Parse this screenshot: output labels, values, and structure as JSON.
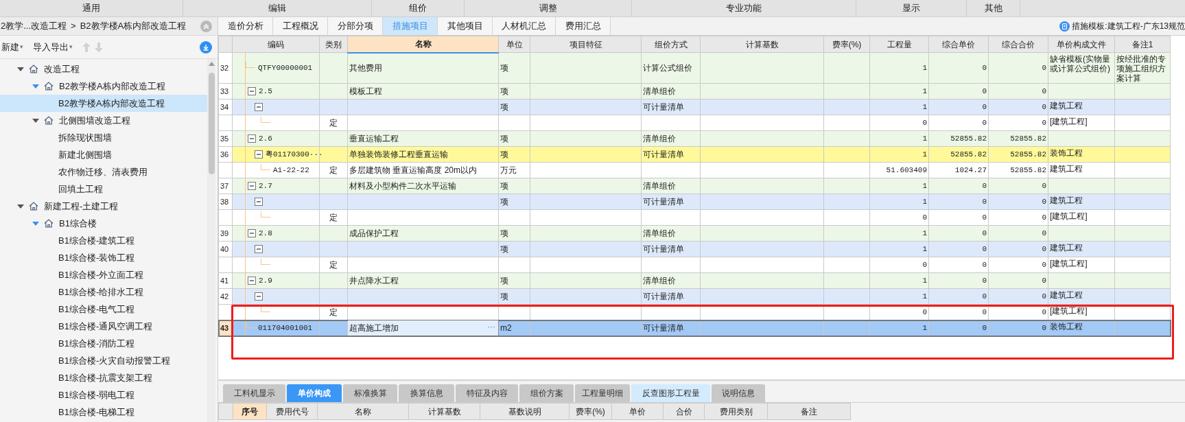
{
  "menu": [
    {
      "label": "通用"
    },
    {
      "label": "编辑"
    },
    {
      "label": "组价"
    },
    {
      "label": "调整"
    },
    {
      "label": "专业功能"
    },
    {
      "label": "显示"
    },
    {
      "label": "其他"
    }
  ],
  "breadcrumb": [
    "2教学...改造工程",
    ">",
    "B2教学楼A栋内部改造工程"
  ],
  "toolbar": [
    {
      "label": "新建",
      "caret": "▾"
    },
    {
      "label": "导入导出",
      "caret": "▾"
    }
  ],
  "tree": [
    {
      "label": "改造工程",
      "expanded": true,
      "selected": false,
      "children": [
        {
          "label": "B2教学楼A栋内部改造工程",
          "expanded": true,
          "selected": false,
          "children": [
            {
              "label": "B2教学楼A栋内部改造工程",
              "selected": true
            }
          ]
        },
        {
          "label": "北侧围墙改造工程",
          "expanded": true,
          "selected": false,
          "children": [
            {
              "label": "拆除现状围墙",
              "selected": false
            },
            {
              "label": "新建北侧围墙",
              "selected": false
            },
            {
              "label": "农作物迁移、清表费用",
              "selected": false
            },
            {
              "label": "回填土工程",
              "selected": false
            }
          ]
        }
      ]
    },
    {
      "label": "新建工程-土建工程",
      "expanded": true,
      "selected": false,
      "children": [
        {
          "label": "B1综合楼",
          "expanded": true,
          "selected": false,
          "children": [
            {
              "label": "B1综合楼-建筑工程",
              "selected": false
            },
            {
              "label": "B1综合楼-装饰工程",
              "selected": false
            },
            {
              "label": "B1综合楼-外立面工程",
              "selected": false
            },
            {
              "label": "B1综合楼-给排水工程",
              "selected": false
            },
            {
              "label": "B1综合楼-电气工程",
              "selected": false
            },
            {
              "label": "B1综合楼-通风空调工程",
              "selected": false
            },
            {
              "label": "B1综合楼-消防工程",
              "selected": false
            },
            {
              "label": "B1综合楼-火灾自动报警工程",
              "selected": false
            },
            {
              "label": "B1综合楼-抗震支架工程",
              "selected": false
            },
            {
              "label": "B1综合楼-弱电工程",
              "selected": false
            },
            {
              "label": "B1综合楼-电梯工程",
              "selected": false
            }
          ]
        }
      ]
    }
  ],
  "tabs": [
    {
      "label": "造价分析",
      "selected": false
    },
    {
      "label": "工程概况",
      "selected": false
    },
    {
      "label": "分部分项",
      "selected": false
    },
    {
      "label": "措施项目",
      "selected": true
    },
    {
      "label": "其他项目",
      "selected": false
    },
    {
      "label": "人材机汇总",
      "selected": false
    },
    {
      "label": "费用汇总",
      "selected": false
    }
  ],
  "template_label": "措施模板:建筑工程-广东13规范",
  "table": {
    "columns": [
      {
        "label": "编码",
        "selected": false
      },
      {
        "label": "类别",
        "selected": false
      },
      {
        "label": "名称",
        "selected": true
      },
      {
        "label": "单位",
        "selected": false
      },
      {
        "label": "项目特征",
        "selected": false
      },
      {
        "label": "组价方式",
        "selected": false
      },
      {
        "label": "计算基数",
        "selected": false
      },
      {
        "label": "费率(%)",
        "selected": false
      },
      {
        "label": "工程量",
        "selected": false
      },
      {
        "label": "综合单价",
        "selected": false
      },
      {
        "label": "综合合价",
        "selected": false
      },
      {
        "label": "单价构成文件",
        "selected": false
      },
      {
        "label": "备注1",
        "selected": false
      }
    ],
    "rows": [
      {
        "number": "32",
        "kind": "measure",
        "selected": false,
        "highlighted": false,
        "code": "QTFY00000001",
        "name": "其他费用",
        "unit": "项",
        "method": "计算公式组价",
        "quantity": "1",
        "unit_price": "0",
        "total_price": "0",
        "price_file": "缺省模板(实物量或计算公式组价)",
        "note1": "按经批准的专项施工组织方案计算"
      },
      {
        "number": "33",
        "kind": "measure",
        "selected": false,
        "highlighted": false,
        "expanded": true,
        "code": "2.5",
        "name": "模板工程",
        "unit": "项",
        "method": "清单组价",
        "quantity": "1",
        "unit_price": "0",
        "total_price": "0",
        "children": [
          {
            "number": "34",
            "kind": "list",
            "selected": false,
            "highlighted": false,
            "expanded": true,
            "unit": "项",
            "method": "可计量清单",
            "quantity": "1",
            "unit_price": "0",
            "total_price": "0",
            "price_file": "建筑工程",
            "children": [
              {
                "kind": "quota",
                "selected": false,
                "highlighted": false,
                "type": "定",
                "quantity": "0",
                "unit_price": "0",
                "total_price": "0",
                "price_file": "[建筑工程]"
              }
            ]
          }
        ]
      },
      {
        "number": "35",
        "kind": "measure",
        "selected": false,
        "highlighted": false,
        "expanded": true,
        "code": "2.6",
        "name": "垂直运输工程",
        "unit": "项",
        "method": "清单组价",
        "quantity": "1",
        "unit_price": "52855.82",
        "total_price": "52855.82",
        "children": [
          {
            "number": "36",
            "kind": "list",
            "selected": false,
            "highlighted": true,
            "expanded": true,
            "code": "粤01170300···",
            "name": "单独装饰装修工程垂直运输",
            "unit": "项",
            "method": "可计量清单",
            "quantity": "1",
            "unit_price": "52855.82",
            "total_price": "52855.82",
            "price_file": "装饰工程",
            "children": [
              {
                "kind": "quota",
                "selected": false,
                "highlighted": false,
                "code": "A1-22-22",
                "type": "定",
                "name": "多层建筑物 垂直运输高度 20m以内",
                "unit": "万元",
                "quantity": "51.603409",
                "unit_price": "1024.27",
                "total_price": "52855.82",
                "price_file": "建筑工程"
              }
            ]
          }
        ]
      },
      {
        "number": "37",
        "kind": "measure",
        "selected": false,
        "highlighted": false,
        "expanded": true,
        "code": "2.7",
        "name": "材料及小型构件二次水平运输",
        "unit": "项",
        "method": "清单组价",
        "quantity": "1",
        "unit_price": "0",
        "total_price": "0",
        "children": [
          {
            "number": "38",
            "kind": "list",
            "selected": false,
            "highlighted": false,
            "expanded": true,
            "unit": "项",
            "method": "可计量清单",
            "quantity": "1",
            "unit_price": "0",
            "total_price": "0",
            "price_file": "建筑工程",
            "children": [
              {
                "kind": "quota",
                "selected": false,
                "highlighted": false,
                "type": "定",
                "quantity": "0",
                "unit_price": "0",
                "total_price": "0",
                "price_file": "[建筑工程]"
              }
            ]
          }
        ]
      },
      {
        "number": "39",
        "kind": "measure",
        "selected": false,
        "highlighted": false,
        "expanded": true,
        "code": "2.8",
        "name": "成品保护工程",
        "unit": "项",
        "method": "清单组价",
        "quantity": "1",
        "unit_price": "0",
        "total_price": "0",
        "children": [
          {
            "number": "40",
            "kind": "list",
            "selected": false,
            "highlighted": false,
            "expanded": true,
            "unit": "项",
            "method": "可计量清单",
            "quantity": "1",
            "unit_price": "0",
            "total_price": "0",
            "price_file": "建筑工程",
            "children": [
              {
                "kind": "quota",
                "selected": false,
                "highlighted": false,
                "type": "定",
                "quantity": "0",
                "unit_price": "0",
                "total_price": "0",
                "price_file": "[建筑工程]"
              }
            ]
          }
        ]
      },
      {
        "number": "41",
        "kind": "measure",
        "selected": false,
        "highlighted": false,
        "expanded": true,
        "code": "2.9",
        "name": "井点降水工程",
        "unit": "项",
        "method": "清单组价",
        "quantity": "1",
        "unit_price": "0",
        "total_price": "0",
        "children": [
          {
            "number": "42",
            "kind": "list",
            "selected": false,
            "highlighted": false,
            "expanded": true,
            "unit": "项",
            "method": "可计量清单",
            "quantity": "1",
            "unit_price": "0",
            "total_price": "0",
            "price_file": "建筑工程",
            "children": [
              {
                "kind": "quota",
                "selected": false,
                "highlighted": false,
                "type": "定",
                "quantity": "0",
                "unit_price": "0",
                "total_price": "0",
                "price_file": "[建筑工程]"
              }
            ]
          }
        ]
      },
      {
        "number": "43",
        "kind": "list",
        "selected": true,
        "highlighted": false,
        "code": "011704001001",
        "name": "超高施工增加",
        "name_button": "···",
        "unit": "m2",
        "method": "可计量清单",
        "quantity": "1",
        "unit_price": "0",
        "total_price": "0",
        "price_file": "装饰工程"
      }
    ]
  },
  "bottom_tabs": [
    {
      "label": "工料机显示",
      "selected": false,
      "highlighted": false
    },
    {
      "label": "单价构成",
      "selected": true,
      "highlighted": false
    },
    {
      "label": "标准换算",
      "selected": false,
      "highlighted": false
    },
    {
      "label": "换算信息",
      "selected": false,
      "highlighted": false
    },
    {
      "label": "特征及内容",
      "selected": false,
      "highlighted": false
    },
    {
      "label": "组价方案",
      "selected": false,
      "highlighted": false
    },
    {
      "label": "工程量明细",
      "selected": false,
      "highlighted": false
    },
    {
      "label": "反查图形工程量",
      "selected": false,
      "highlighted": true
    },
    {
      "label": "说明信息",
      "selected": false,
      "highlighted": false
    }
  ],
  "cost_table": {
    "columns": [
      {
        "label": "序号",
        "selected": true
      },
      {
        "label": "费用代号",
        "selected": false
      },
      {
        "label": "名称",
        "selected": false
      },
      {
        "label": "计算基数",
        "selected": false
      },
      {
        "label": "基数说明",
        "selected": false
      },
      {
        "label": "费率(%)",
        "selected": false
      },
      {
        "label": "单价",
        "selected": false
      },
      {
        "label": "合价",
        "selected": false
      },
      {
        "label": "费用类别",
        "selected": false
      },
      {
        "label": "备注",
        "selected": false
      }
    ]
  }
}
